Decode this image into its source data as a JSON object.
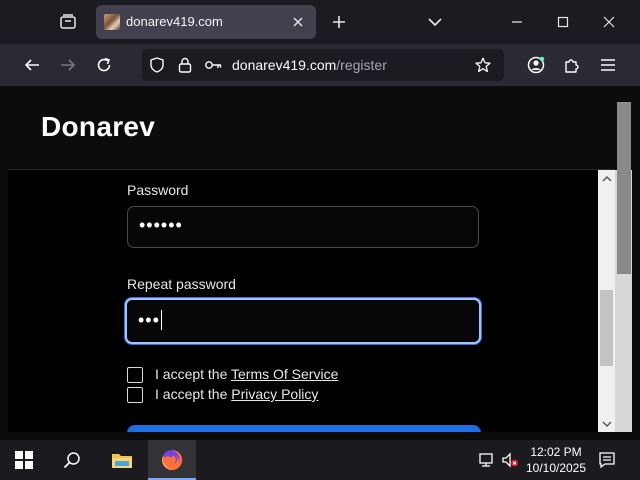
{
  "browser": {
    "tab_title": "donarev419.com",
    "url_host": "donarev419.com",
    "url_path": "/register"
  },
  "page": {
    "logo": "Donarev",
    "password_label": "Password",
    "password_value": "••••••",
    "repeat_label": "Repeat password",
    "repeat_value": "•••",
    "tos_prefix": "I accept the ",
    "tos_link": "Terms Of Service",
    "privacy_prefix": "I accept the ",
    "privacy_link": "Privacy Policy"
  },
  "taskbar": {
    "time": "12:02 PM",
    "date": "10/10/2025"
  },
  "colors": {
    "accent": "#1f6fe0",
    "focus_ring": "#9ec3ff"
  }
}
